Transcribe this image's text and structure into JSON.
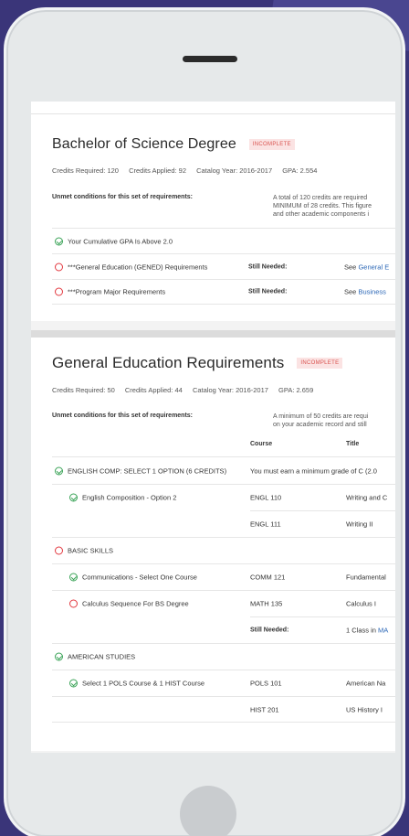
{
  "card1": {
    "title": "Bachelor of Science Degree",
    "badge": "INCOMPLETE",
    "credits_required": "Credits Required:  120",
    "credits_applied": "Credits Applied:  92",
    "catalog_year": "Catalog Year:  2016-2017",
    "gpa": "GPA:  2.554",
    "unmet_label": "Unmet conditions for this set of requirements:",
    "desc_lines": [
      "A total of 120 credits are required",
      "MINIMUM of 28 credits. This figure",
      "and other academic components i"
    ],
    "rows": [
      {
        "status": "ok",
        "name": "Your Cumulative GPA Is Above 2.0",
        "still": "",
        "see": "",
        "link": ""
      },
      {
        "status": "bad",
        "name": "***General Education (GENED) Requirements",
        "still": "Still Needed:",
        "see": "See",
        "link": "General E"
      },
      {
        "status": "bad",
        "name": "***Program Major Requirements",
        "still": "Still Needed:",
        "see": "See",
        "link": "Business"
      }
    ]
  },
  "card2": {
    "title": "General Education Requirements",
    "badge": "INCOMPLETE",
    "credits_required": "Credits Required:  50",
    "credits_applied": "Credits Applied:  44",
    "catalog_year": "Catalog Year:  2016-2017",
    "gpa": "GPA:  2.659",
    "unmet_label": "Unmet conditions for this set of requirements:",
    "desc_lines": [
      "A minimum of 50 credits are requi",
      "on your academic record and still"
    ],
    "col_course": "Course",
    "col_title": "Title",
    "rows": [
      {
        "status": "ok",
        "indent": false,
        "name": "ENGLISH COMP: SELECT 1 OPTION (6 CREDITS)",
        "course": "You must earn a minimum grade of C (2.0",
        "title": ""
      },
      {
        "status": "ok",
        "indent": true,
        "name": "English Composition - Option 2",
        "course": "ENGL 110",
        "title": "Writing and C"
      },
      {
        "status": "",
        "indent": true,
        "name": "",
        "course": "ENGL 111",
        "title": "Writing II"
      },
      {
        "status": "bad",
        "indent": false,
        "name": "BASIC SKILLS",
        "course": "",
        "title": ""
      },
      {
        "status": "ok",
        "indent": true,
        "name": "Communications - Select One Course",
        "course": "COMM 121",
        "title": "Fundamental"
      },
      {
        "status": "bad",
        "indent": true,
        "name": "Calculus Sequence For BS Degree",
        "course": "MATH 135",
        "title": "Calculus I"
      },
      {
        "status": "",
        "indent": true,
        "name": "",
        "course": "Still Needed:",
        "title": "1 Class in",
        "title_link": "MA"
      },
      {
        "status": "ok",
        "indent": false,
        "name": "AMERICAN STUDIES",
        "course": "",
        "title": ""
      },
      {
        "status": "ok",
        "indent": true,
        "name": "Select 1 POLS Course & 1 HIST Course",
        "course": "POLS 101",
        "title": "American Na"
      },
      {
        "status": "",
        "indent": true,
        "name": "",
        "course": "HIST 201",
        "title": "US History I"
      }
    ]
  }
}
